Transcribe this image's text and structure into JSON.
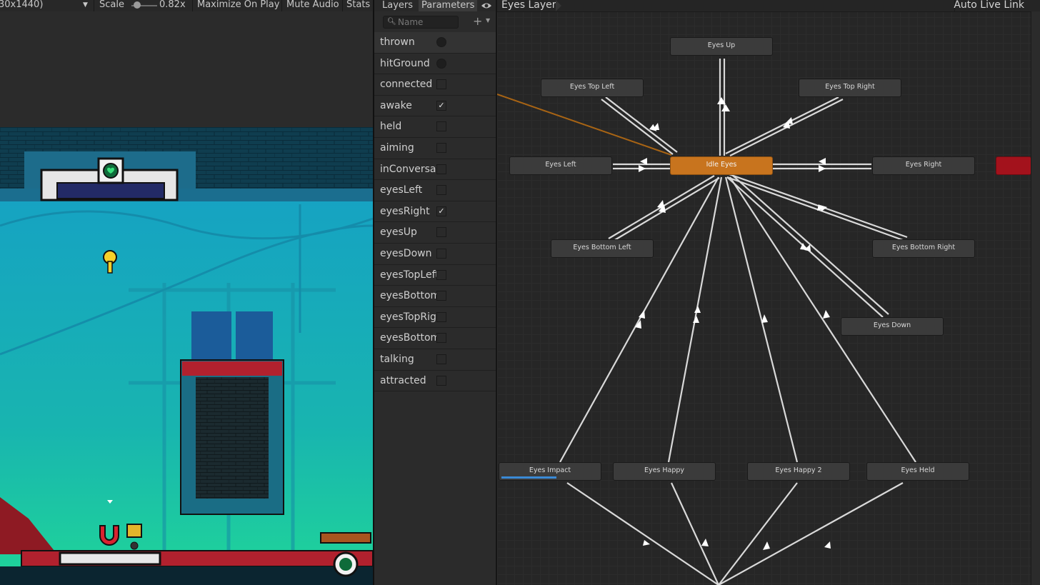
{
  "toolbar": {
    "resolution": "30x1440)",
    "scale_label": "Scale",
    "scale_value": "0.82x",
    "maximize": "Maximize On Play",
    "mute": "Mute Audio",
    "stats": "Stats"
  },
  "panel": {
    "tab_layers": "Layers",
    "tab_parameters": "Parameters",
    "search_placeholder": "Name",
    "params": [
      {
        "name": "thrown",
        "type": "trigger",
        "checked": false
      },
      {
        "name": "hitGround",
        "type": "trigger",
        "checked": false
      },
      {
        "name": "connected",
        "type": "bool",
        "checked": false
      },
      {
        "name": "awake",
        "type": "bool",
        "checked": true
      },
      {
        "name": "held",
        "type": "bool",
        "checked": false
      },
      {
        "name": "aiming",
        "type": "bool",
        "checked": false
      },
      {
        "name": "inConversation",
        "type": "bool",
        "checked": false
      },
      {
        "name": "eyesLeft",
        "type": "bool",
        "checked": false
      },
      {
        "name": "eyesRight",
        "type": "bool",
        "checked": true
      },
      {
        "name": "eyesUp",
        "type": "bool",
        "checked": false
      },
      {
        "name": "eyesDown",
        "type": "bool",
        "checked": false
      },
      {
        "name": "eyesTopLeft",
        "type": "bool",
        "checked": false
      },
      {
        "name": "eyesBottomLeft",
        "type": "bool",
        "checked": false
      },
      {
        "name": "eyesTopRight",
        "type": "bool",
        "checked": false
      },
      {
        "name": "eyesBottomRight",
        "type": "bool",
        "checked": false
      },
      {
        "name": "talking",
        "type": "bool",
        "checked": false
      },
      {
        "name": "attracted",
        "type": "bool",
        "checked": false
      }
    ]
  },
  "graph": {
    "layer_name": "Eyes Layer",
    "live_link": "Auto Live Link",
    "states": {
      "eyes_up": "Eyes Up",
      "eyes_top_left": "Eyes Top Left",
      "eyes_top_right": "Eyes Top Right",
      "eyes_left": "Eyes Left",
      "idle_eyes": "Idle Eyes",
      "eyes_right": "Eyes Right",
      "eyes_bottom_left": "Eyes Bottom Left",
      "eyes_bottom_right": "Eyes Bottom Right",
      "eyes_down": "Eyes Down",
      "eyes_impact": "Eyes Impact",
      "eyes_happy": "Eyes Happy",
      "eyes_happy_2": "Eyes Happy 2",
      "eyes_held": "Eyes Held"
    },
    "impact_progress": 0.55,
    "colors": {
      "default_state": "#c8741e",
      "any_state": "#a3121c",
      "active_transition": "#b86a12"
    }
  }
}
